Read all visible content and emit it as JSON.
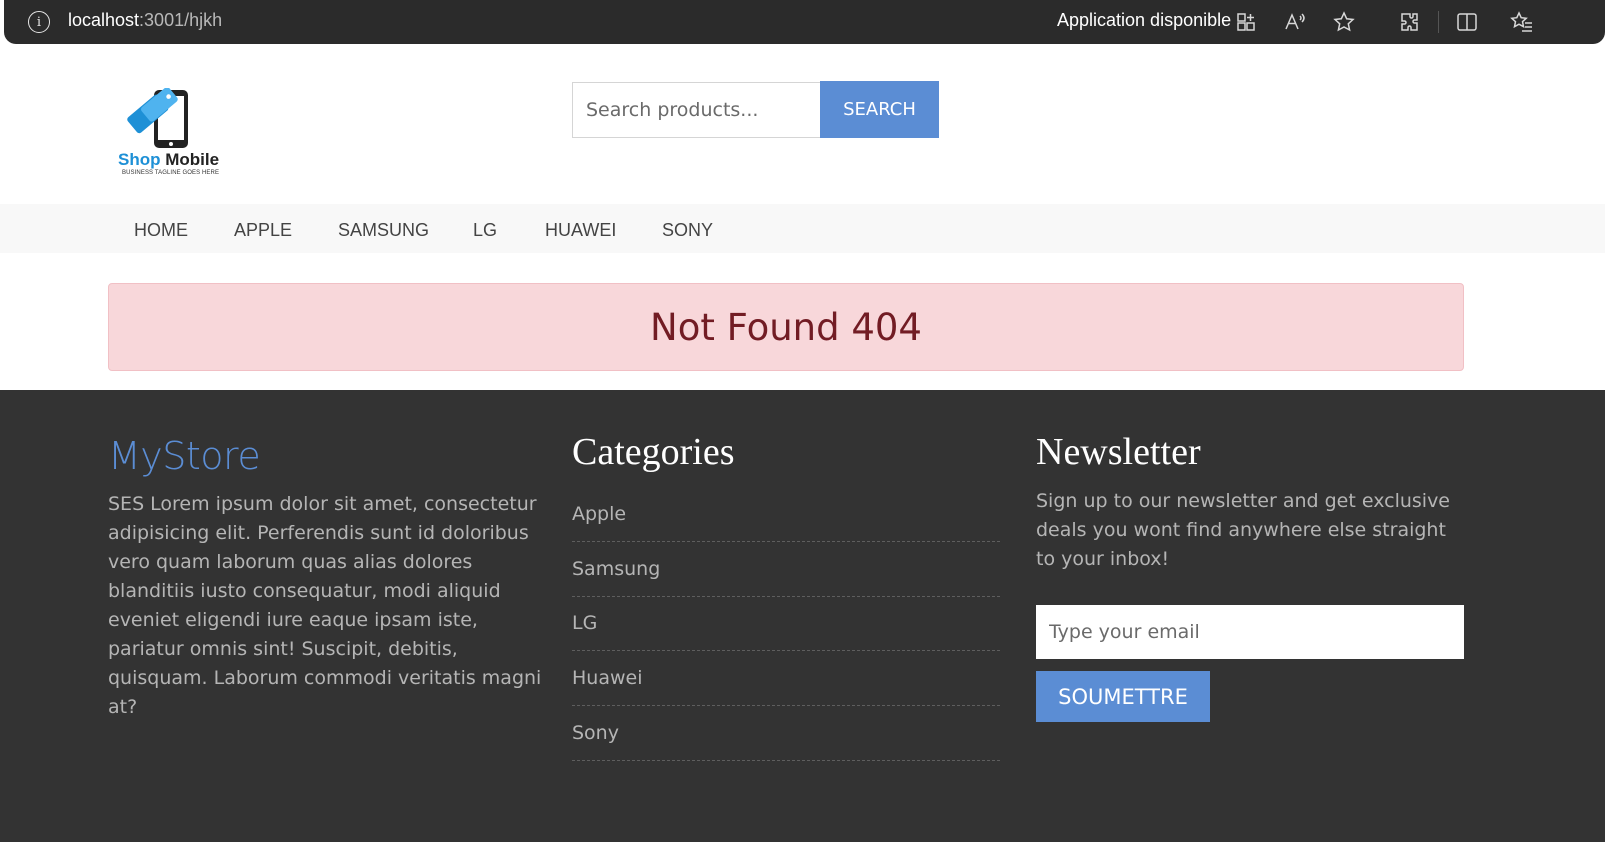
{
  "browser": {
    "url_host": "localhost",
    "url_path": ":3001/hjkh",
    "app_available": "Application disponible"
  },
  "header": {
    "logo_brand_shop": "Shop",
    "logo_brand_mobile": " Mobile",
    "logo_tagline": "BUSINESS TAGLINE GOES HERE",
    "search_placeholder": "Search products...",
    "search_button": "SEARCH"
  },
  "nav": {
    "items": [
      {
        "label": "HOME"
      },
      {
        "label": "APPLE"
      },
      {
        "label": "SAMSUNG"
      },
      {
        "label": "LG"
      },
      {
        "label": "HUAWEI"
      },
      {
        "label": "SONY"
      }
    ]
  },
  "alert": {
    "message": "Not Found 404"
  },
  "footer": {
    "store": {
      "title": "MyStore",
      "description": "SES Lorem ipsum dolor sit amet, consectetur adipisicing elit. Perferendis sunt id doloribus vero quam laborum quas alias dolores blanditiis iusto consequatur, modi aliquid eveniet eligendi iure eaque ipsam iste, pariatur omnis sint! Suscipit, debitis, quisquam. Laborum commodi veritatis magni at?"
    },
    "categories": {
      "title": "Categories",
      "items": [
        {
          "label": "Apple"
        },
        {
          "label": "Samsung"
        },
        {
          "label": "LG"
        },
        {
          "label": "Huawei"
        },
        {
          "label": "Sony"
        }
      ]
    },
    "newsletter": {
      "title": "Newsletter",
      "description": "Sign up to our newsletter and get exclusive deals you wont find anywhere else straight to your inbox!",
      "email_placeholder": "Type your email",
      "submit_button": "SOUMETTRE"
    }
  },
  "colors": {
    "accent": "#5b8dd4",
    "footer_bg": "#333333",
    "alert_bg": "#f8d7da",
    "alert_text": "#721c24"
  }
}
